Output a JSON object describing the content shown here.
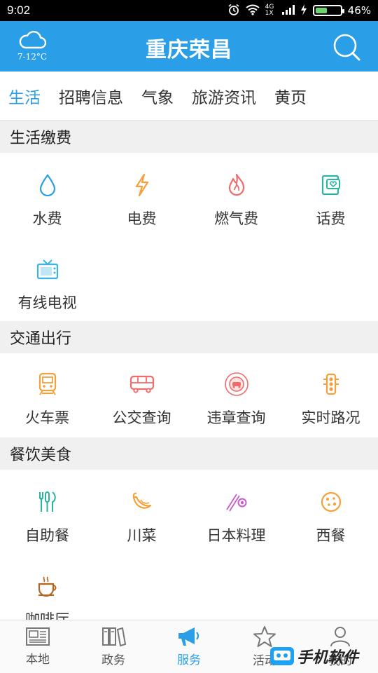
{
  "status_bar": {
    "time": "9:02",
    "network": "4G 1X",
    "battery_percent": "46%",
    "battery_level": 0.46
  },
  "header": {
    "weather_temp": "7-12°C",
    "weather_icon": "cloud-icon",
    "title": "重庆荣昌",
    "search_icon": "search-icon",
    "bg_color": "#2a9fe8"
  },
  "tabs": [
    {
      "label": "生活",
      "active": true
    },
    {
      "label": "招聘信息"
    },
    {
      "label": "气象"
    },
    {
      "label": "旅游资讯"
    },
    {
      "label": "黄页"
    }
  ],
  "sections": [
    {
      "title": "生活缴费",
      "items": [
        {
          "label": "水费",
          "icon": "water-drop-icon",
          "color": "#2a9fe8"
        },
        {
          "label": "电费",
          "icon": "lightning-icon",
          "color": "#f5a03a"
        },
        {
          "label": "燃气费",
          "icon": "flame-icon",
          "color": "#f26b6b"
        },
        {
          "label": "话费",
          "icon": "phone-bill-icon",
          "color": "#2bb5a0"
        },
        {
          "label": "有线电视",
          "icon": "tv-icon",
          "color": "#3ab3e6"
        }
      ]
    },
    {
      "title": "交通出行",
      "items": [
        {
          "label": "火车票",
          "icon": "train-icon",
          "color": "#f5a03a"
        },
        {
          "label": "公交查询",
          "icon": "bus-icon",
          "color": "#f26b6b"
        },
        {
          "label": "违章查询",
          "icon": "traffic-violation-icon",
          "color": "#f26b6b"
        },
        {
          "label": "实时路况",
          "icon": "traffic-light-icon",
          "color": "#f5a03a"
        }
      ]
    },
    {
      "title": "餐饮美食",
      "items": [
        {
          "label": "自助餐",
          "icon": "cutlery-icon",
          "color": "#2bb5a0"
        },
        {
          "label": "川菜",
          "icon": "pepper-icon",
          "color": "#f5a03a"
        },
        {
          "label": "日本料理",
          "icon": "sushi-icon",
          "color": "#c95bd1"
        },
        {
          "label": "西餐",
          "icon": "cookie-icon",
          "color": "#f5a03a"
        },
        {
          "label": "咖啡厅",
          "icon": "coffee-icon",
          "color": "#b5651d"
        }
      ]
    }
  ],
  "bottom_nav": [
    {
      "label": "本地",
      "icon": "newspaper-icon"
    },
    {
      "label": "政务",
      "icon": "books-icon"
    },
    {
      "label": "服务",
      "icon": "megaphone-icon",
      "active": true
    },
    {
      "label": "活动",
      "icon": "star-icon"
    },
    {
      "label": "我的",
      "icon": "user-icon"
    }
  ],
  "watermark_text": "手机软件"
}
